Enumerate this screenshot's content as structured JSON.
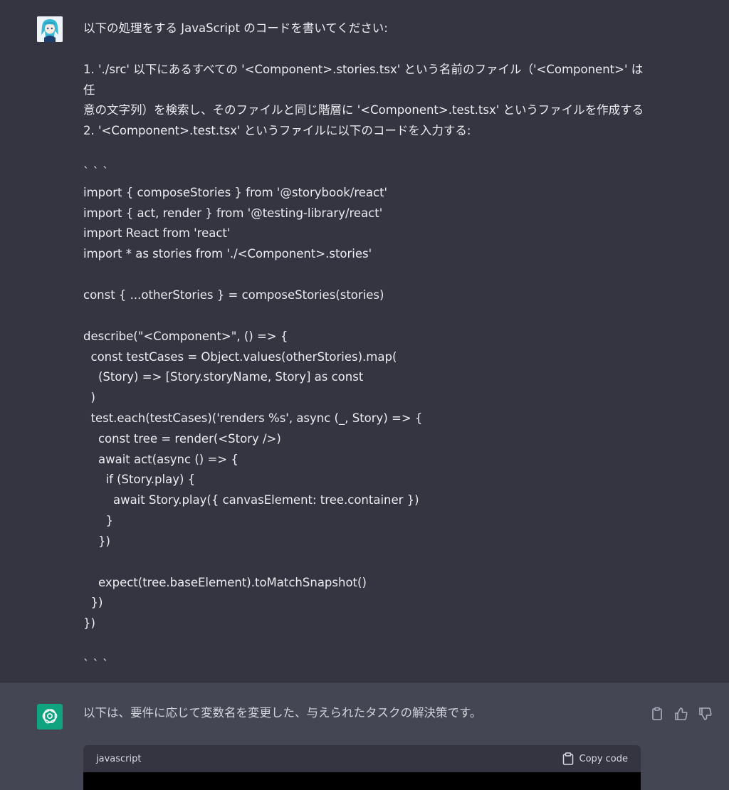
{
  "user_message": {
    "lines": [
      "以下の処理をする JavaScript のコードを書いてください:",
      "",
      "1. './src' 以下にあるすべての '<Component>.stories.tsx' という名前のファイル（'<Component>' は任",
      "意の文字列）を検索し、そのファイルと同じ階層に '<Component>.test.tsx' というファイルを作成する",
      "2. '<Component>.test.tsx' というファイルに以下のコードを入力する:",
      "",
      "` ` `",
      "import { composeStories } from '@storybook/react'",
      "import { act, render } from '@testing-library/react'",
      "import React from 'react'",
      "import * as stories from './<Component>.stories'",
      "",
      "const { ...otherStories } = composeStories(stories)",
      "",
      "describe(\"<Component>\", () => {",
      "  const testCases = Object.values(otherStories).map(",
      "    (Story) => [Story.storyName, Story] as const",
      "  )",
      "  test.each(testCases)('renders %s', async (_, Story) => {",
      "    const tree = render(<Story />)",
      "    await act(async () => {",
      "      if (Story.play) {",
      "        await Story.play({ canvasElement: tree.container })",
      "      }",
      "    })",
      "",
      "    expect(tree.baseElement).toMatchSnapshot()",
      "  })",
      "})",
      "",
      "` ` `"
    ]
  },
  "assistant_message": {
    "text": "以下は、要件に応じて変数名を変更した、与えられたタスクの解決策です。",
    "code_language": "javascript",
    "copy_label": "Copy code"
  },
  "icons": {
    "user_avatar": "user-avatar-image",
    "bot_avatar": "chatgpt-logo-icon",
    "copy": "clipboard-icon",
    "thumbs_up": "thumbs-up-icon",
    "thumbs_down": "thumbs-down-icon"
  },
  "colors": {
    "background": "#343541",
    "assistant_background": "#444654",
    "accent": "#10a37f",
    "code_background": "#000000"
  }
}
